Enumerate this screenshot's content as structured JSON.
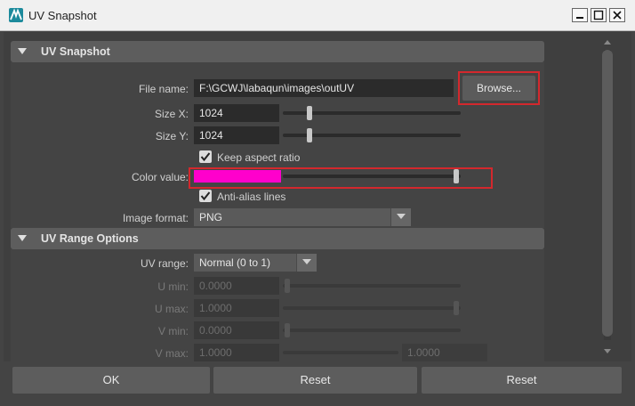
{
  "window": {
    "title": "UV Snapshot",
    "controls": [
      "minimize-icon",
      "maximize-icon",
      "close-icon"
    ]
  },
  "uv_snapshot": {
    "header": "UV Snapshot",
    "file_name_label": "File name:",
    "file_name_value": "F:\\GCWJ\\labaqun\\images\\outUV",
    "browse_label": "Browse...",
    "size_x_label": "Size X:",
    "size_x_value": "1024",
    "size_y_label": "Size Y:",
    "size_y_value": "1024",
    "keep_aspect_label": "Keep aspect ratio",
    "keep_aspect_checked": true,
    "color_value_label": "Color value:",
    "color_value_hex": "#ff00cc",
    "anti_alias_label": "Anti-alias lines",
    "anti_alias_checked": true,
    "image_format_label": "Image format:",
    "image_format_value": "PNG"
  },
  "uv_range": {
    "header": "UV Range Options",
    "uv_range_label": "UV range:",
    "uv_range_value": "Normal (0 to 1)",
    "u_min_label": "U min:",
    "u_min_value": "0.0000",
    "u_max_label": "U max:",
    "u_max_value": "1.0000",
    "v_min_label": "V min:",
    "v_min_value": "0.0000",
    "v_max_label": "V max:",
    "v_max_value": "1.0000",
    "v_max_value_2": "1.0000"
  },
  "buttons": {
    "ok": "OK",
    "reset_1": "Reset",
    "reset_2": "Reset"
  },
  "colors": {
    "highlight_box": "#d3282d",
    "panel_bg": "#444444",
    "section_header": "#5d5d5d"
  }
}
